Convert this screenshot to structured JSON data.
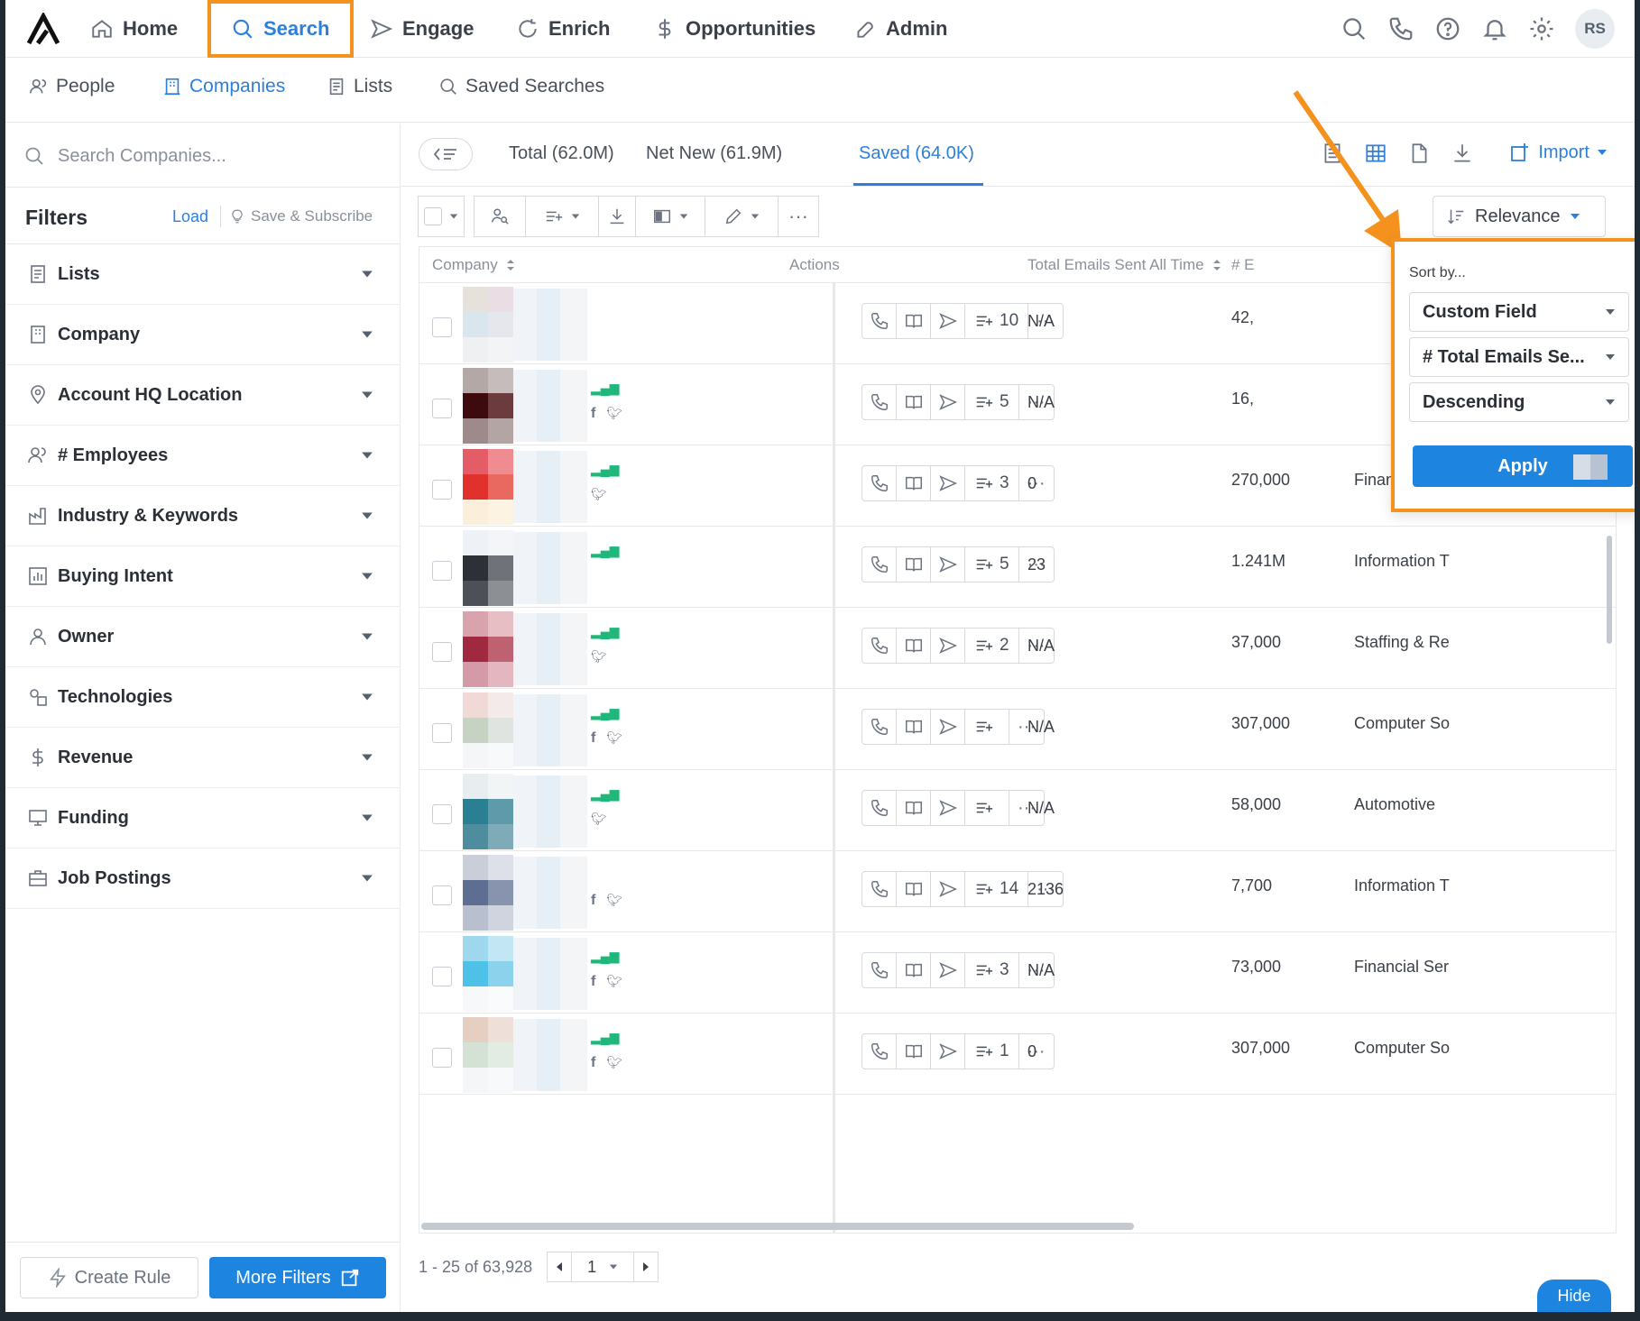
{
  "nav": {
    "items": [
      {
        "label": "Home",
        "icon": "home-icon"
      },
      {
        "label": "Search",
        "icon": "search-icon"
      },
      {
        "label": "Engage",
        "icon": "send-icon"
      },
      {
        "label": "Enrich",
        "icon": "refresh-icon"
      },
      {
        "label": "Opportunities",
        "icon": "dollar-icon"
      },
      {
        "label": "Admin",
        "icon": "wrench-icon"
      }
    ],
    "avatar": "RS"
  },
  "subnav": {
    "items": [
      {
        "label": "People"
      },
      {
        "label": "Companies"
      },
      {
        "label": "Lists"
      },
      {
        "label": "Saved Searches"
      }
    ]
  },
  "sidebar": {
    "search_placeholder": "Search Companies...",
    "filters_title": "Filters",
    "load": "Load",
    "save_subscribe": "Save & Subscribe",
    "filters": [
      "Lists",
      "Company",
      "Account HQ Location",
      "# Employees",
      "Industry & Keywords",
      "Buying Intent",
      "Owner",
      "Technologies",
      "Revenue",
      "Funding",
      "Job Postings"
    ],
    "create_rule": "Create Rule",
    "more_filters": "More Filters"
  },
  "main": {
    "tabs": [
      "Total (62.0M)",
      "Net New (61.9M)",
      "Saved (64.0K)"
    ],
    "import": "Import",
    "relevance": "Relevance",
    "columns": {
      "company": "Company",
      "actions": "Actions",
      "emails": "Total Emails Sent All Time",
      "partial": "# E"
    },
    "rows": [
      {
        "seq": "10",
        "emails": "N/A",
        "emp": "42,",
        "industry": ""
      },
      {
        "seq": "5",
        "emails": "N/A",
        "emp": "16,",
        "industry": ""
      },
      {
        "seq": "3",
        "emails": "0",
        "emp": "270,000",
        "industry": "Financial Ser"
      },
      {
        "seq": "5",
        "emails": "23",
        "emp": "1.241M",
        "industry": "Information T"
      },
      {
        "seq": "2",
        "emails": "N/A",
        "emp": "37,000",
        "industry": "Staffing & Re"
      },
      {
        "seq": "",
        "emails": "N/A",
        "emp": "307,000",
        "industry": "Computer So"
      },
      {
        "seq": "",
        "emails": "N/A",
        "emp": "58,000",
        "industry": "Automotive"
      },
      {
        "seq": "14",
        "emails": "2136",
        "emp": "7,700",
        "industry": "Information T"
      },
      {
        "seq": "3",
        "emails": "N/A",
        "emp": "73,000",
        "industry": "Financial Ser"
      },
      {
        "seq": "1",
        "emails": "0",
        "emp": "307,000",
        "industry": "Computer So"
      }
    ],
    "pager": {
      "range": "1 - 25 of 63,928",
      "page": "1"
    },
    "hide": "Hide"
  },
  "sort_popover": {
    "title": "Sort by...",
    "field_type": "Custom Field",
    "field": "# Total Emails Se...",
    "direction": "Descending",
    "apply": "Apply"
  },
  "colors": {
    "accent": "#2d7fd9",
    "highlight": "#f5921e",
    "primary_button": "#1d84e0",
    "signal": "#1fb87a"
  }
}
